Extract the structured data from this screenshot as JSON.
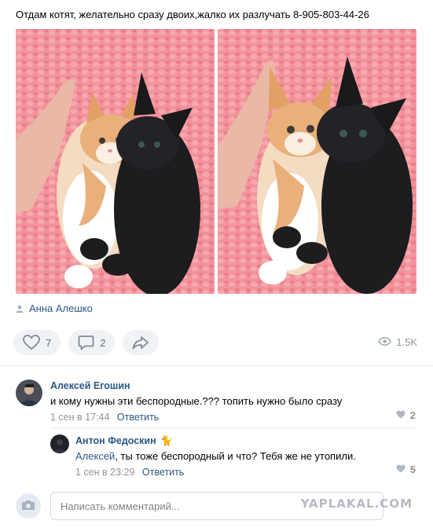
{
  "post": {
    "text": "Отдам котят, желательно сразу двоих,жалко их разлучать 8-905-803-44-26",
    "author": "Анна Алешко"
  },
  "actions": {
    "likes": "7",
    "comments": "2",
    "views": "1.5K"
  },
  "comments": [
    {
      "name": "Алексей Егошин",
      "text": "и кому нужны эти беспородные.??? топить нужно было сразу",
      "date": "1 сен в 17:44",
      "reply_label": "Ответить",
      "likes": "2"
    },
    {
      "name": "Антон Федоскин",
      "name_emoji": "🐈",
      "mention": "Алексей",
      "text": ", ты тоже беспородный и что? Тебя же не утопили.",
      "date": "1 сен в 23:29",
      "reply_label": "Ответить",
      "likes": "5"
    }
  ],
  "composer": {
    "placeholder": "Написать комментарий..."
  },
  "watermark": "YAPLAKAL.COM",
  "colors": {
    "link": "#2a5885",
    "muted": "#939393",
    "button_bg": "#f0f2f5",
    "blanket": "#f08a93"
  }
}
